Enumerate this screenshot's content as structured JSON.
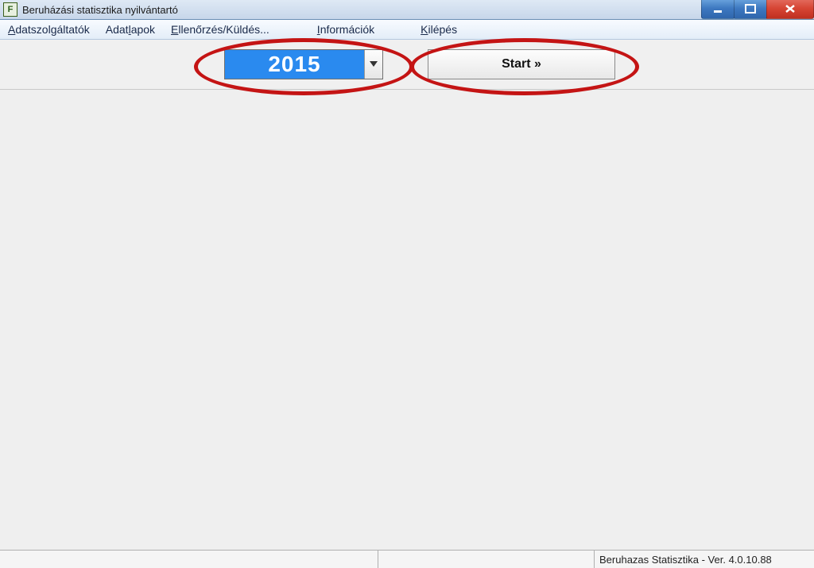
{
  "window": {
    "title": "Beruházási statisztika nyilvántartó",
    "icon_letter": "F"
  },
  "menu": {
    "items": [
      {
        "label": "Adatszolgáltatók",
        "ul_index": 0
      },
      {
        "label": "Adatlapok",
        "ul_index": 4
      },
      {
        "label": "Ellenőrzés/Küldés...",
        "ul_index": 0
      },
      {
        "label": "Információk",
        "ul_index": 0
      },
      {
        "label": "Kilépés",
        "ul_index": 0
      }
    ]
  },
  "toolbar": {
    "year_value": "2015",
    "start_label": "Start »"
  },
  "statusbar": {
    "version_text": "Beruhazas Statisztika - Ver. 4.0.10.88"
  },
  "annotation": {
    "color": "#c41414"
  }
}
